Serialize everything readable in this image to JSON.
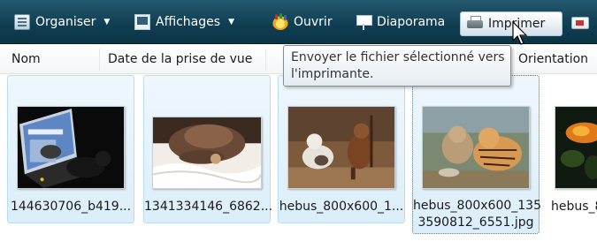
{
  "toolbar": {
    "organiser_label": "Organiser",
    "affichages_label": "Affichages",
    "ouvrir_label": "Ouvrir",
    "diaporama_label": "Diaporama",
    "imprimer_label": "Imprimer",
    "organiser_icon": "organise-icon",
    "affichages_icon": "views-icon",
    "ouvrir_icon": "open-with-photo-gallery-icon",
    "diaporama_icon": "slideshow-icon",
    "imprimer_icon": "printer-icon",
    "mail_icon": "email-icon",
    "dropdown_icon": "chevron-down-icon"
  },
  "columns": [
    "Nom",
    "Date de la prise de vue",
    "Orientation"
  ],
  "tooltip": {
    "line1": "Envoyer le fichier sélectionné vers",
    "line2": "l'imprimante."
  },
  "files": [
    {
      "name": "144630706_b419...",
      "selected": true,
      "focused": false,
      "thumb": "cat-on-laptop-photo"
    },
    {
      "name": "1341334146_6862...",
      "selected": true,
      "focused": false,
      "thumb": "cat-under-hat-photo"
    },
    {
      "name": "hebus_800x600_1...",
      "selected": true,
      "focused": false,
      "thumb": "cat-and-fox-photo"
    },
    {
      "name_line1": "hebus_800x600_135",
      "name_line2": "3590812_6551.jpg",
      "selected": true,
      "focused": true,
      "thumb": "cat-and-tiger-cub-photo"
    },
    {
      "name": "hebus_8",
      "selected": false,
      "focused": false,
      "thumb": "goldfish-photo"
    }
  ],
  "colors": {
    "toolbar_top": "#24586f",
    "toolbar_bottom": "#0c3446",
    "selection_fill": "#dbeefa",
    "selection_border": "#b9dcf0"
  }
}
